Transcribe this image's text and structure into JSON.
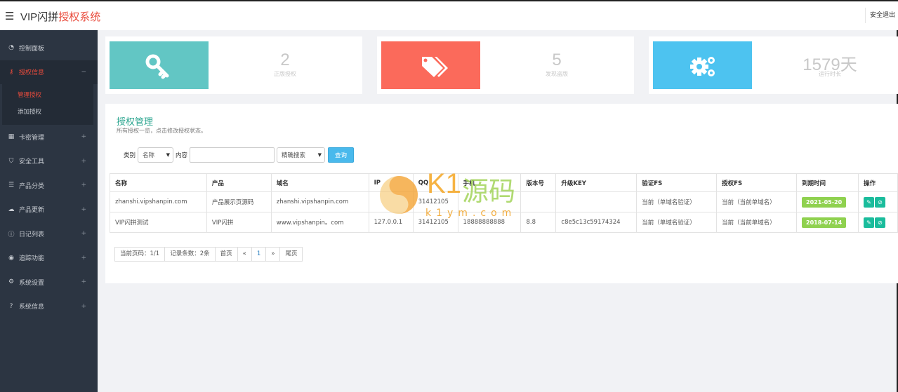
{
  "header": {
    "menu_icon": "hamburger-icon",
    "brand_main": "VIP闪拼",
    "brand_accent": "授权系统",
    "logout": "安全退出"
  },
  "sidebar": {
    "items": [
      {
        "label": "控制面板",
        "icon": "dashboard-icon"
      },
      {
        "label": "授权信息",
        "icon": "key-icon",
        "expand": "−"
      },
      {
        "label": "卡密管理",
        "icon": "barcode-icon",
        "expand": "+"
      },
      {
        "label": "安全工具",
        "icon": "shield-icon",
        "expand": "+"
      },
      {
        "label": "产品分类",
        "icon": "list-icon",
        "expand": "+"
      },
      {
        "label": "产品更新",
        "icon": "cloud-upload-icon",
        "expand": "+"
      },
      {
        "label": "日记列表",
        "icon": "info-icon",
        "expand": "+"
      },
      {
        "label": "追踪功能",
        "icon": "eye-icon",
        "expand": "+"
      },
      {
        "label": "系统设置",
        "icon": "gears-icon",
        "expand": "+"
      },
      {
        "label": "系统信息",
        "icon": "question-icon",
        "expand": "+"
      }
    ],
    "sub_items": [
      "管理授权",
      "添加授权"
    ]
  },
  "stats": [
    {
      "value": "2",
      "label": "正版授权",
      "color": "#62c6c4",
      "icon": "key-icon"
    },
    {
      "value": "5",
      "label": "发现盗版",
      "color": "#fb6a5b",
      "icon": "tags-icon"
    },
    {
      "value": "1579天",
      "label": "运行时长",
      "color": "#4dc3f0",
      "icon": "gears-icon"
    }
  ],
  "panel": {
    "title": "授权管理",
    "subtitle": "所有授权一览，点击修改授权状态。",
    "search": {
      "category_label": "类别",
      "category_value": "名称",
      "content_label": "内容",
      "content_value": "",
      "mode_value": "精确搜索",
      "query_button": "查询"
    }
  },
  "table": {
    "headers": [
      "名称",
      "产品",
      "域名",
      "IP",
      "QQ",
      "手机",
      "版本号",
      "升级KEY",
      "验证FS",
      "授权FS",
      "到期时间",
      "操作"
    ],
    "rows": [
      {
        "name": "zhanshi.vipshanpin.com",
        "product": "产品展示页源码",
        "domain": "zhanshi.vipshanpin.com",
        "ip": "",
        "qq": "31412105",
        "phone": "",
        "version": "",
        "key": "",
        "verify": "当前（单域名验证）",
        "auth": "当前（当前单域名）",
        "expire": "2021-05-20"
      },
      {
        "name": "VIP闪拼测试",
        "product": "VIP闪拼",
        "domain": "www.vipshanpin。com",
        "ip": "127.0.0.1",
        "qq": "31412105",
        "phone": "18888888888",
        "version": "8.8",
        "key": "c8e5c13c59174324",
        "verify": "当前（单域名验证）",
        "auth": "当前（当前单域名）",
        "expire": "2018-07-14"
      }
    ],
    "edit_icon": "edit-icon",
    "ban_icon": "ban-icon"
  },
  "pager": {
    "current": "当前页码：1/1",
    "records": "记录条数：2条",
    "first": "首页",
    "prev": "«",
    "page": "1",
    "next": "»",
    "last": "尾页"
  },
  "watermark": {
    "brand": "K1",
    "brand_cn": "源码",
    "url": "k1ym.com"
  }
}
